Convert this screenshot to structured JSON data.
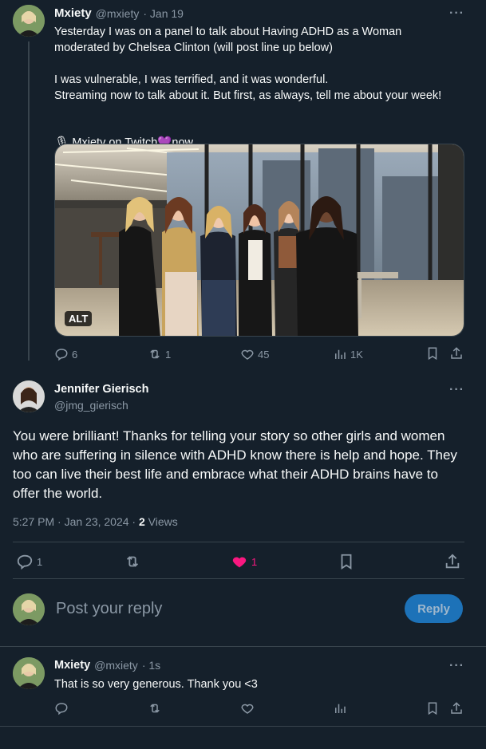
{
  "tweet1": {
    "name": "Mxiety",
    "handle": "@mxiety",
    "date": "· Jan 19",
    "text": "Yesterday I was on a panel to talk about Having ADHD as a Woman\nmoderated by Chelsea Clinton (will post line up below)\n\nI was vulnerable, I was terrified, and it was wonderful.\nStreaming now to talk about it. But first, as always, tell me about your week!",
    "twitch_prefix": "🎙 Mxiety on Twitch",
    "twitch_suffix": "now",
    "alt_badge": "ALT",
    "replies": "6",
    "reposts": "1",
    "likes": "45",
    "views": "1K"
  },
  "tweet2": {
    "name": "Jennifer Gierisch",
    "handle": "@jmg_gierisch",
    "text": "You were brilliant! Thanks for telling your story so other girls and women who are suffering in silence with ADHD know there is help and hope. They too can live their best life and embrace what their ADHD brains have to offer the world.",
    "timestamp": "5:27 PM · Jan 23, 2024 · ",
    "views_count": "2",
    "views_label": " Views",
    "replies": "1",
    "likes": "1",
    "like_color": "#f91880"
  },
  "compose": {
    "placeholder": "Post your reply",
    "button": "Reply"
  },
  "tweet3": {
    "name": "Mxiety",
    "handle": "@mxiety",
    "date": "· 1s",
    "text": "That is so very generous. Thank you <3"
  },
  "more_label": "···"
}
